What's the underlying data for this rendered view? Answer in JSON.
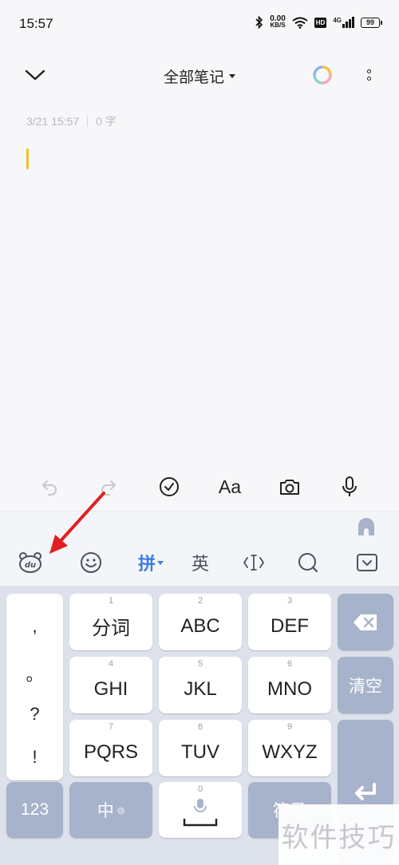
{
  "status_bar": {
    "time": "15:57",
    "speed_value": "0.00",
    "speed_unit": "KB/S",
    "hd": "HD",
    "network": "4G",
    "battery": "99"
  },
  "header": {
    "folder_label": "全部笔记"
  },
  "note": {
    "date": "3/21 15:57",
    "char_count": "0 字"
  },
  "toolbar": {
    "format_label": "Aa"
  },
  "ime_bar": {
    "pinyin_label": "拼",
    "english_label": "英"
  },
  "keyboard": {
    "punctuation": [
      ",",
      "。",
      "?",
      "!"
    ],
    "keys": [
      {
        "num": "1",
        "label": "分词"
      },
      {
        "num": "2",
        "label": "ABC"
      },
      {
        "num": "3",
        "label": "DEF"
      },
      {
        "num": "4",
        "label": "GHI"
      },
      {
        "num": "5",
        "label": "JKL"
      },
      {
        "num": "6",
        "label": "MNO"
      },
      {
        "num": "7",
        "label": "PQRS"
      },
      {
        "num": "8",
        "label": "TUV"
      },
      {
        "num": "9",
        "label": "WXYZ"
      }
    ],
    "clear_label": "清空",
    "numbers_label": "123",
    "chinese_label": "中",
    "space_num": "0",
    "symbols_label": "符号"
  },
  "watermark": "软件技巧",
  "colors": {
    "accent": "#3d7ce6",
    "cursor": "#f3c224",
    "annotation": "#e02020",
    "dark_key": "#a7b3cb"
  }
}
